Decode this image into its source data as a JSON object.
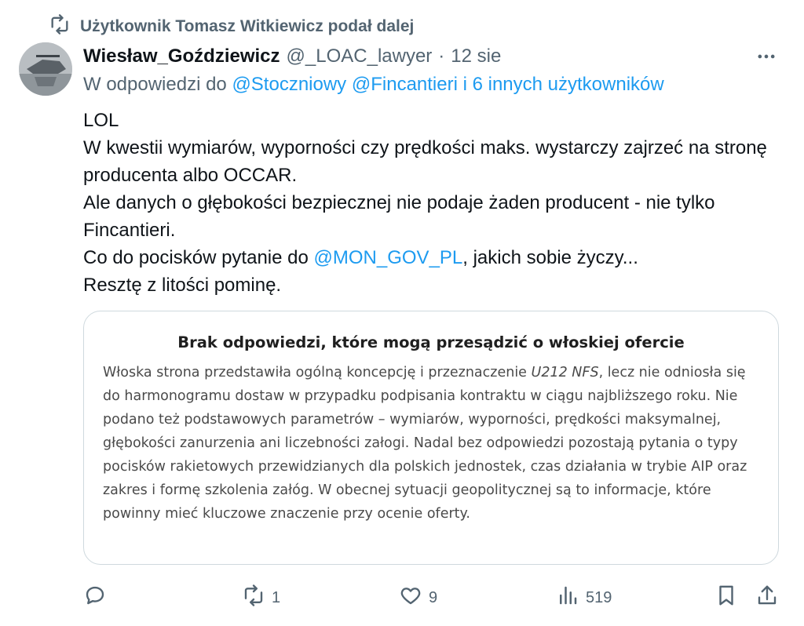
{
  "retweet": {
    "label": "Użytkownik Tomasz Witkiewicz podał dalej"
  },
  "tweet": {
    "author_name": "Wiesław_Goździewicz",
    "handle": "@_LOAC_lawyer",
    "separator": "·",
    "date": "12 sie",
    "reply_prefix": "W odpowiedzi do",
    "reply_user_1": "@Stoczniowy",
    "reply_user_2": "@Fincantieri",
    "reply_others": "i 6 innych użytkowników",
    "line1": "LOL",
    "line2": "W kwestii wymiarów, wyporności czy prędkości maks. wystarczy zajrzeć na stronę producenta albo OCCAR.",
    "line3": "Ale danych o głębokości bezpiecznej nie podaje żaden producent - nie tylko Fincantieri.",
    "line4_prefix": "Co do pocisków pytanie do",
    "line4_mention": "@MON_GOV_PL",
    "line4_suffix": ", jakich sobie życzy...",
    "line5": "Resztę z litości pominę."
  },
  "card": {
    "title": "Brak odpowiedzi, które mogą przesądzić o włoskiej ofercie",
    "text_before": "Włoska strona przedstawiła ogólną koncepcję i przeznaczenie ",
    "text_italic": "U212 NFS",
    "text_after": ", lecz nie odniosła się do harmonogramu dostaw w przypadku podpisania kontraktu w ciągu najbliższego roku. Nie podano też podstawowych parametrów – wymiarów, wyporności, prędkości maksymalnej, głębokości zanurzenia ani liczebności załogi. Nadal bez odpowiedzi pozostają pytania o typy pocisków rakietowych przewidzianych dla polskich jednostek, czas działania w trybie AIP oraz zakres i formę szkolenia załóg. W obecnej sytuacji geopolitycznej są to informacje, które powinny mieć kluczowe znaczenie przy ocenie oferty."
  },
  "actions": {
    "reply_count": "",
    "retweet_count": "1",
    "like_count": "9",
    "view_count": "519"
  },
  "colors": {
    "link": "#1d9bf0",
    "muted": "#536471",
    "text": "#0f1419",
    "border": "#cfd9de"
  },
  "icons": [
    "retweet-icon",
    "more-icon",
    "reply-icon",
    "like-icon",
    "views-icon",
    "bookmark-icon",
    "share-icon"
  ]
}
